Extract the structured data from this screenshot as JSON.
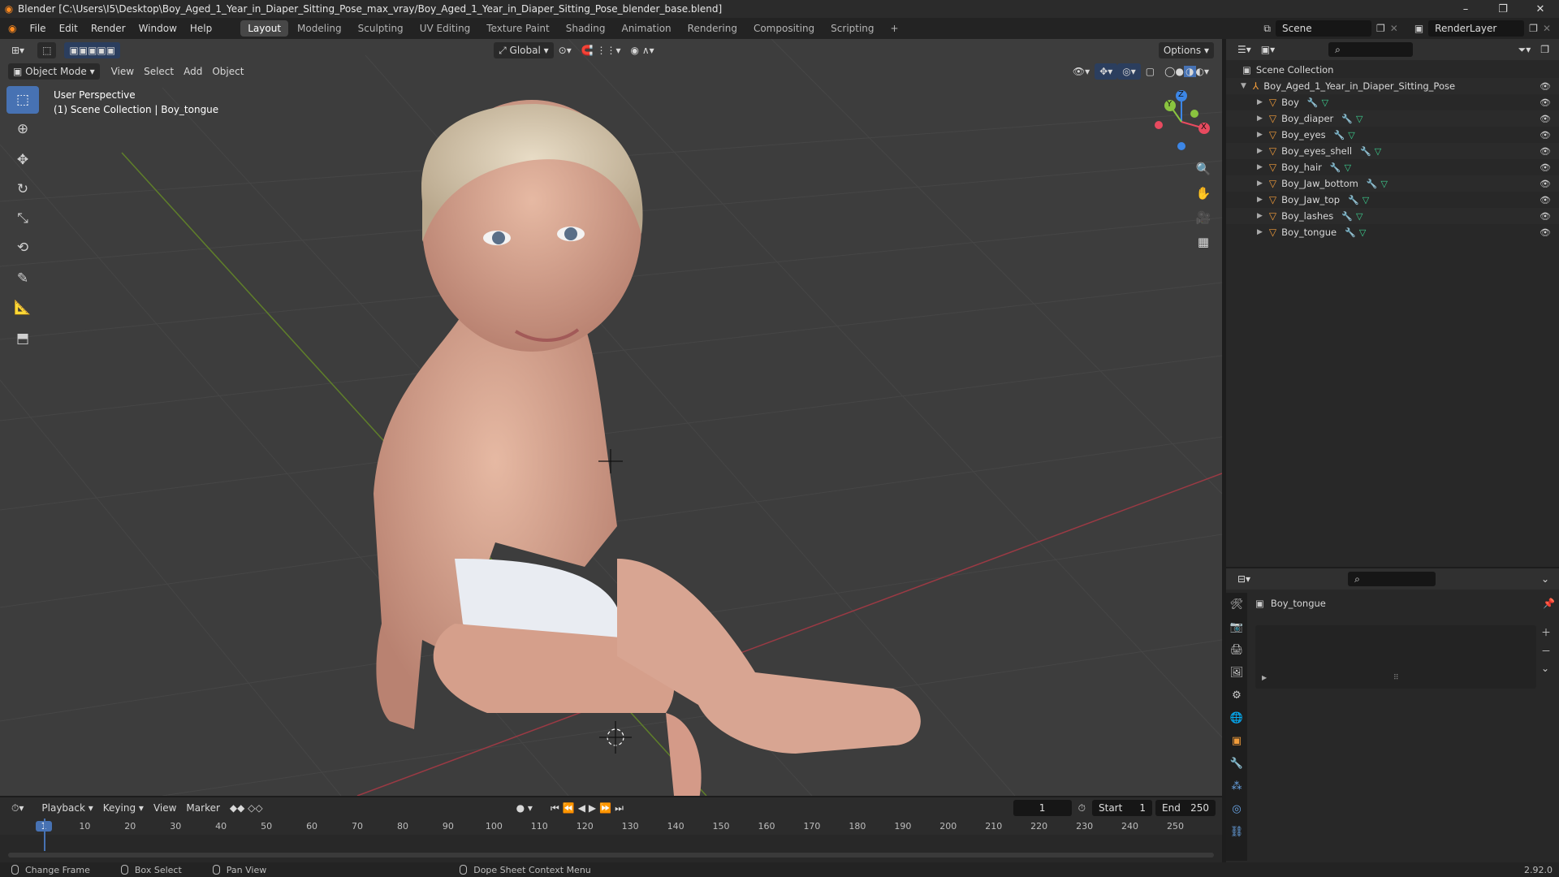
{
  "window": {
    "title": "Blender [C:\\Users\\I5\\Desktop\\Boy_Aged_1_Year_in_Diaper_Sitting_Pose_max_vray/Boy_Aged_1_Year_in_Diaper_Sitting_Pose_blender_base.blend]",
    "controls": [
      "–",
      "❐",
      "✕"
    ]
  },
  "menubar": {
    "menus": [
      "File",
      "Edit",
      "Render",
      "Window",
      "Help"
    ],
    "workspaces": [
      "Layout",
      "Modeling",
      "Sculpting",
      "UV Editing",
      "Texture Paint",
      "Shading",
      "Animation",
      "Rendering",
      "Compositing",
      "Scripting"
    ],
    "active_workspace": "Layout",
    "add_tab": "+",
    "scene_label": "Scene",
    "view_layer_label": "RenderLayer"
  },
  "viewport": {
    "mode": "Object Mode",
    "menus": [
      "View",
      "Select",
      "Add",
      "Object"
    ],
    "transform_orientation": "Global",
    "options_label": "Options",
    "perspective_label": "User Perspective",
    "collection_label": "(1) Scene Collection | Boy_tongue",
    "gizmo_axes": {
      "z": "Z",
      "y": "Y",
      "x": "X"
    }
  },
  "outliner": {
    "root": "Scene Collection",
    "collection": "Boy_Aged_1_Year_in_Diaper_Sitting_Pose",
    "objects": [
      "Boy",
      "Boy_diaper",
      "Boy_eyes",
      "Boy_eyes_shell",
      "Boy_hair",
      "Boy_Jaw_bottom",
      "Boy_Jaw_top",
      "Boy_lashes",
      "Boy_tongue"
    ]
  },
  "properties": {
    "active_object": "Boy_tongue"
  },
  "timeline": {
    "menus": [
      "Playback",
      "Keying",
      "View",
      "Marker"
    ],
    "current_frame": "1",
    "start_label": "Start",
    "start_value": "1",
    "end_label": "End",
    "end_value": "250",
    "ticks": [
      "1",
      "10",
      "20",
      "30",
      "40",
      "50",
      "60",
      "70",
      "80",
      "90",
      "100",
      "110",
      "120",
      "130",
      "140",
      "150",
      "160",
      "170",
      "180",
      "190",
      "200",
      "210",
      "220",
      "230",
      "240",
      "250"
    ]
  },
  "statusbar": {
    "items": [
      "Change Frame",
      "Box Select",
      "Pan View",
      "Dope Sheet Context Menu"
    ],
    "version": "2.92.0"
  },
  "colors": {
    "accent": "#4772b3",
    "object_orange": "#f29c3a",
    "x_axis": "#e84a5f",
    "y_axis": "#8ac43f",
    "z_axis": "#3c86e6"
  }
}
